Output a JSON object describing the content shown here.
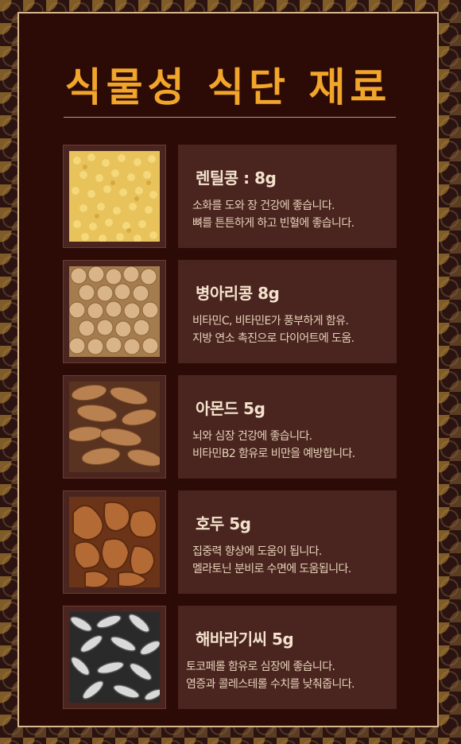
{
  "title": "식물성 식단 재료",
  "items": [
    {
      "name": "렌틸콩 : 8g",
      "desc": [
        "소화를 도와 장 건강에 좋습니다.",
        "뼈를 튼튼하게 하고 빈혈에 좋습니다."
      ],
      "image": "lentils-photo"
    },
    {
      "name": "병아리콩 8g",
      "desc": [
        "비타민C, 비타민E가 풍부하게 함유.",
        "지방 연소 촉진으로 다이어트에 도움."
      ],
      "image": "chickpeas-photo"
    },
    {
      "name": "아몬드 5g",
      "desc": [
        "뇌와 심장 건강에 좋습니다.",
        "비타민B2 함유로  비만을 예방합니다."
      ],
      "image": "almonds-photo"
    },
    {
      "name": "호두 5g",
      "desc": [
        "집중력 향상에 도움이 됩니다.",
        "멜라토닌 분비로 수면에 도움됩니다."
      ],
      "image": "walnuts-photo"
    },
    {
      "name": "해바라기씨 5g",
      "desc": [
        "토코페롤 함유로 심장에 좋습니다.",
        "염증과 콜레스테롤 수치를 낮춰줍니다."
      ],
      "image": "sunflower-seeds-photo"
    }
  ],
  "colors": {
    "title": "#f1a52a",
    "frame": "#d9b98e",
    "card": "#4a2520",
    "background": "#2c0a06"
  }
}
